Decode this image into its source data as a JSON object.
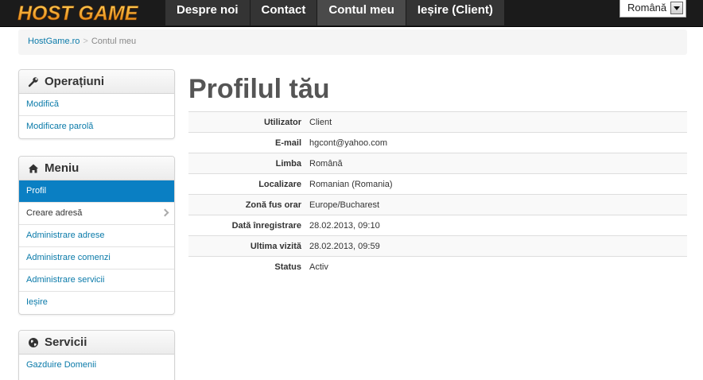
{
  "brand": {
    "logo_text": "HOST GAME"
  },
  "nav": {
    "items": [
      {
        "label": "Despre noi"
      },
      {
        "label": "Contact"
      },
      {
        "label": "Contul meu"
      },
      {
        "label": "Ieșire (Client)"
      }
    ],
    "active_index": 2
  },
  "language": {
    "selected": "Română"
  },
  "breadcrumb": {
    "home": "HostGame.ro",
    "separator": ">",
    "current": "Contul meu"
  },
  "operatiuni": {
    "title": "Operațiuni",
    "icon": "wrench-icon",
    "items": [
      {
        "label": "Modifică"
      },
      {
        "label": "Modificare parolă"
      }
    ]
  },
  "meniu": {
    "title": "Meniu",
    "icon": "home-icon",
    "items": [
      {
        "label": "Profil"
      },
      {
        "label": "Creare adresă"
      },
      {
        "label": "Administrare adrese"
      },
      {
        "label": "Administrare comenzi"
      },
      {
        "label": "Administrare servicii"
      },
      {
        "label": "Ieșire"
      }
    ]
  },
  "servicii": {
    "title": "Servicii",
    "icon": "globe-icon",
    "items": [
      {
        "label": "Gazduire Domenii"
      }
    ]
  },
  "profile": {
    "title": "Profilul tău",
    "rows": [
      {
        "label": "Utilizator",
        "value": "Client"
      },
      {
        "label": "E-mail",
        "value": "hgcont@yahoo.com"
      },
      {
        "label": "Limba",
        "value": "Română"
      },
      {
        "label": "Localizare",
        "value": "Romanian (Romania)"
      },
      {
        "label": "Zonă fus orar",
        "value": "Europe/Bucharest"
      },
      {
        "label": "Dată înregistrare",
        "value": "28.02.2013, 09:10"
      },
      {
        "label": "Ultima vizită",
        "value": "28.02.2013, 09:59"
      },
      {
        "label": "Status",
        "value": "Activ"
      }
    ]
  },
  "colors": {
    "accent": "#0a7fc3",
    "link": "#0a7aa9",
    "topbar": "#1b1b1b",
    "logo": "#f2a11a"
  }
}
